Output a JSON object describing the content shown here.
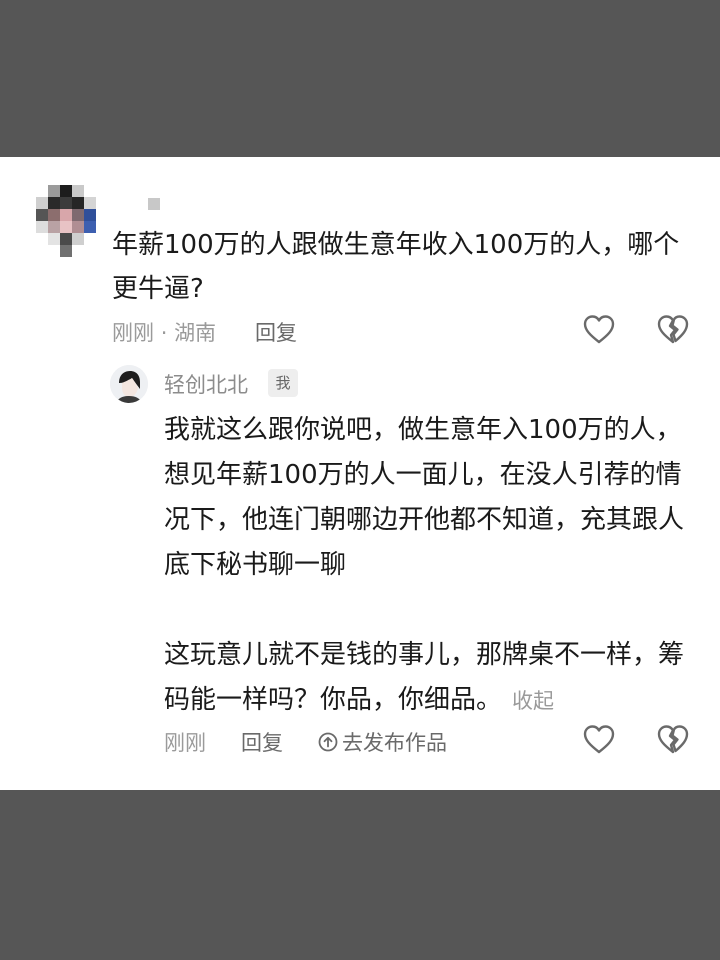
{
  "comment": {
    "text": "年薪100万的人跟做生意年收入100万的人，哪个更牛逼?",
    "time": "刚刚",
    "separator": "·",
    "location": "湖南",
    "reply_label": "回复"
  },
  "reply": {
    "username": "轻创北北",
    "badge": "我",
    "paragraph1": "我就这么跟你说吧，做生意年入100万的人，想见年薪100万的人一面儿，在没人引荐的情况下，他连门朝哪边开他都不知道，充其跟人底下秘书聊一聊",
    "paragraph2": "这玩意儿就不是钱的事儿，那牌桌不一样，筹码能一样吗？你品，你细品。",
    "collapse_label": "收起",
    "time": "刚刚",
    "reply_label": "回复",
    "publish_label": "去发布作品"
  },
  "icons": {
    "like": "heart-icon",
    "dislike": "broken-heart-icon",
    "publish": "up-arrow-circle-icon"
  },
  "colors": {
    "background": "#565656",
    "card": "#ffffff",
    "text": "#1a1a1a",
    "meta": "#9a9a9a"
  }
}
